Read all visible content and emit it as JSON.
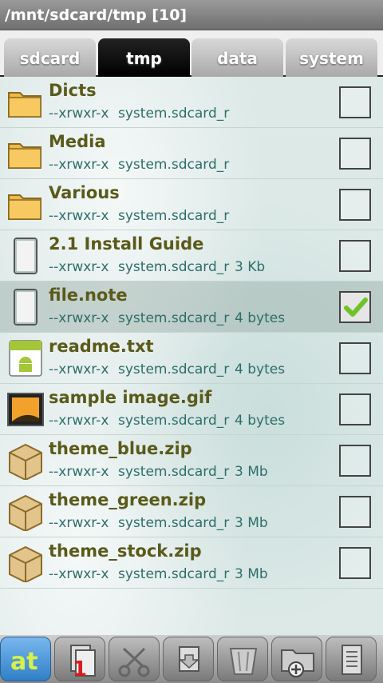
{
  "titlebar": {
    "path": "/mnt/sdcard/tmp  [10]"
  },
  "tabs": [
    {
      "label": "sdcard",
      "active": false
    },
    {
      "label": "tmp",
      "active": true
    },
    {
      "label": "data",
      "active": false
    },
    {
      "label": "system",
      "active": false
    }
  ],
  "files": [
    {
      "name": "Dicts",
      "perm": "--xrwxr-x",
      "owner": "system.sdcard_r",
      "size": "",
      "icon": "folder-icon",
      "checked": false
    },
    {
      "name": "Media",
      "perm": "--xrwxr-x",
      "owner": "system.sdcard_r",
      "size": "",
      "icon": "folder-icon",
      "checked": false
    },
    {
      "name": "Various",
      "perm": "--xrwxr-x",
      "owner": "system.sdcard_r",
      "size": "",
      "icon": "folder-icon",
      "checked": false
    },
    {
      "name": "2.1 Install Guide",
      "perm": "--xrwxr-x",
      "owner": "system.sdcard_r",
      "size": "3 Kb",
      "icon": "document-icon",
      "checked": false
    },
    {
      "name": "file.note",
      "perm": "--xrwxr-x",
      "owner": "system.sdcard_r",
      "size": "4 bytes",
      "icon": "document-icon",
      "checked": true
    },
    {
      "name": "readme.txt",
      "perm": "--xrwxr-x",
      "owner": "system.sdcard_r",
      "size": "4 bytes",
      "icon": "android-text-icon",
      "checked": false
    },
    {
      "name": "sample image.gif",
      "perm": "--xrwxr-x",
      "owner": "system.sdcard_r",
      "size": "4 bytes",
      "icon": "image-icon",
      "checked": false
    },
    {
      "name": "theme_blue.zip",
      "perm": "--xrwxr-x",
      "owner": "system.sdcard_r",
      "size": "3 Mb",
      "icon": "archive-box-icon",
      "checked": false
    },
    {
      "name": "theme_green.zip",
      "perm": "--xrwxr-x",
      "owner": "system.sdcard_r",
      "size": "3 Mb",
      "icon": "archive-box-icon",
      "checked": false
    },
    {
      "name": "theme_stock.zip",
      "perm": "--xrwxr-x",
      "owner": "system.sdcard_r",
      "size": "3 Mb",
      "icon": "archive-box-icon",
      "checked": false
    }
  ],
  "toolbar": {
    "app_logo": "at",
    "pane_number": "1",
    "buttons": [
      "app-logo-icon",
      "copy-pane-icon",
      "scissors-icon",
      "move-down-icon",
      "trash-icon",
      "new-folder-icon",
      "menu-list-icon"
    ]
  }
}
